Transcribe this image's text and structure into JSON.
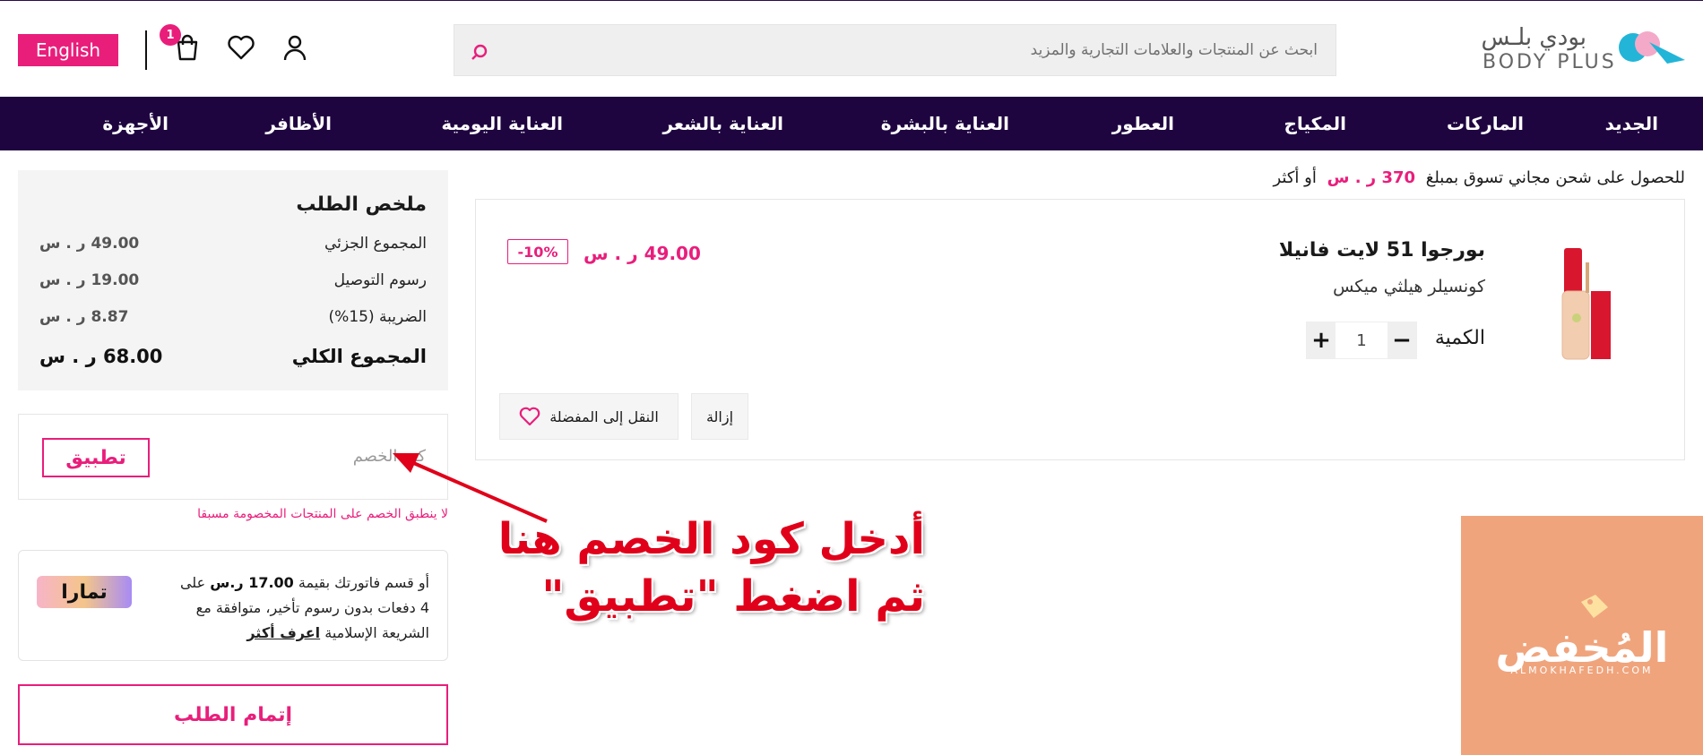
{
  "header": {
    "language_button": "English",
    "cart_count": "1",
    "search_placeholder": "ابحث عن المنتجات والعلامات التجارية والمزيد",
    "logo_ar": "بودي بلـس",
    "logo_en": "BODY PLUS"
  },
  "nav": {
    "items": [
      "الجديد",
      "الماركات",
      "المكياج",
      "العطور",
      "العناية بالبشرة",
      "العناية بالشعر",
      "العناية اليومية",
      "الأظافر",
      "الأجهزة"
    ]
  },
  "shipping": {
    "prefix": "للحصول على شحن مجاني تسوق بمبلغ",
    "amount": "370 ر . س",
    "suffix": "أو أكثر"
  },
  "product": {
    "title": "بورجوا 51 لايت فانيلا",
    "subtitle": "كونسيلر هيلثي ميكس",
    "quantity_label": "الكمية",
    "quantity_value": "1",
    "minus": "−",
    "plus": "+",
    "price": "49.00 ر . س",
    "discount": "-10%",
    "remove_label": "إزالة",
    "wishlist_label": "النقل إلى المفضلة"
  },
  "summary": {
    "title": "ملخص الطلب",
    "rows": [
      {
        "label": "المجموع الجزئي",
        "value": "49.00 ر . س"
      },
      {
        "label": "رسوم التوصيل",
        "value": "19.00 ر . س"
      },
      {
        "label": "الضريبة (15%)",
        "value": "8.87 ر . س"
      }
    ],
    "total_label": "المجموع الكلي",
    "total_value": "68.00 ر . س"
  },
  "coupon": {
    "placeholder": "كود الخصم",
    "apply_label": "تطبيق",
    "note": "لا ينطبق الخصم على المنتجات المخصومة مسبقا"
  },
  "tamara": {
    "text_part1": "أو قسم فاتورتك بقيمة",
    "amount": "17.00 ر.س",
    "text_part2": "على 4 دفعات بدون رسوم تأخير، متوافقة مع الشريعة الإسلامية",
    "learn_more": "اعرف أكثر",
    "logo_text": "تمارا"
  },
  "checkout": {
    "label": "إتمام الطلب"
  },
  "annotation": {
    "line1": "أدخل كود الخصم هنا",
    "line2": "ثم اضغط \"تطبيق\""
  },
  "watermark": {
    "text": "المُخفض",
    "sub": "ALMOKHAFEDH.COM"
  },
  "colors": {
    "accent": "#e91e7b",
    "nav_bg": "#1f0540",
    "annotation": "#e0001a",
    "watermark_bg": "#f0a47c"
  }
}
